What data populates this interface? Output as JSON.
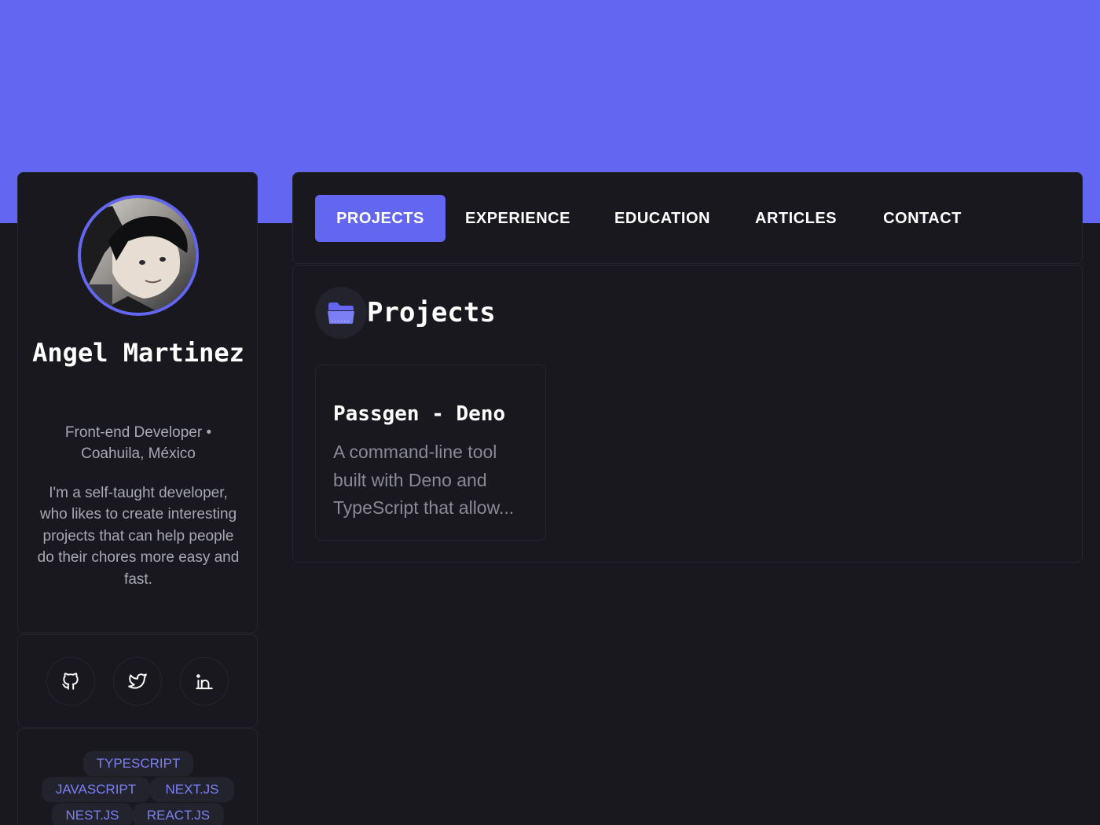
{
  "colors": {
    "accent": "#6366f1",
    "background": "#18181e",
    "card_border": "#26262e",
    "muted_text": "#a8a8b3",
    "tag_text": "#7c7ff3"
  },
  "profile": {
    "avatar_alt": "Angel Martinez avatar",
    "name": "Angel Martinez",
    "role": "Front-end Developer • Coahuila, México",
    "bio": "I'm a self-taught developer, who likes to create interesting projects that can help people do their chores more easy and fast."
  },
  "socials": [
    {
      "icon": "github-icon"
    },
    {
      "icon": "twitter-icon"
    },
    {
      "icon": "linkedin-icon"
    }
  ],
  "skills": [
    "TYPESCRIPT",
    "JAVASCRIPT",
    "NEXT.JS",
    "NEST.JS",
    "REACT.JS"
  ],
  "tabs": [
    {
      "label": "PROJECTS",
      "active": true
    },
    {
      "label": "EXPERIENCE",
      "active": false
    },
    {
      "label": "EDUCATION",
      "active": false
    },
    {
      "label": "ARTICLES",
      "active": false
    },
    {
      "label": "CONTACT",
      "active": false
    }
  ],
  "projects_section": {
    "icon": "folder-icon",
    "title": "Projects",
    "items": [
      {
        "title": "Passgen - Deno",
        "description": "A command-line tool built with Deno and TypeScript that allow..."
      }
    ]
  }
}
